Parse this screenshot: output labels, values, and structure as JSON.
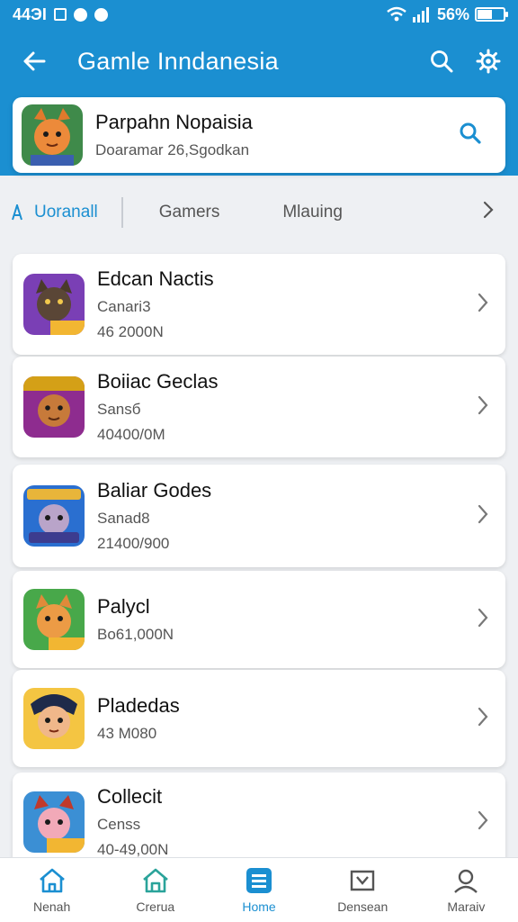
{
  "status_bar": {
    "time": "44ЭI",
    "battery": "56%",
    "battery_level": 0.56
  },
  "toolbar": {
    "title": "Gamle Inndanesia",
    "back_icon": "arrow-left-icon",
    "search_icon": "search-icon",
    "settings_icon": "gear-icon"
  },
  "featured": {
    "title": "Parpahn Nopaisia",
    "subtitle": "Doaramar 26,Sgodkan"
  },
  "tabs": [
    {
      "label": "Uoranall",
      "active": true
    },
    {
      "label": "Gamers",
      "active": false
    },
    {
      "label": "Mlauing",
      "active": false
    }
  ],
  "games": [
    {
      "name": "Edcan Nactis",
      "lines": [
        "Canari3",
        "46 2000N"
      ]
    },
    {
      "name": "Boiiac Geclas",
      "lines": [
        "Sansб",
        "40400/0M"
      ]
    },
    {
      "name": "Baliar Godes",
      "lines": [
        "Sanad8",
        "21400/900"
      ]
    },
    {
      "name": "Palycl",
      "lines": [
        "Bo61,000N"
      ]
    },
    {
      "name": "Pladedas",
      "lines": [
        "43 M080"
      ]
    },
    {
      "name": "Collecit",
      "lines": [
        "Censs",
        "40-49,00N"
      ]
    }
  ],
  "bottom_nav": [
    {
      "label": "Nenah",
      "icon": "home-icon",
      "active": false
    },
    {
      "label": "Crerua",
      "icon": "store-icon",
      "active": false
    },
    {
      "label": "Home",
      "icon": "menu-icon",
      "active": true
    },
    {
      "label": "Densean",
      "icon": "download-icon",
      "active": false
    },
    {
      "label": "Maraiv",
      "icon": "profile-icon",
      "active": false
    }
  ],
  "colors": {
    "primary": "#1b8fd1",
    "background": "#eef0f3",
    "card": "#ffffff"
  }
}
